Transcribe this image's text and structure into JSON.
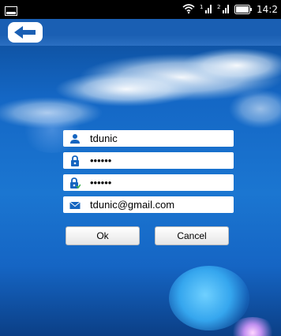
{
  "status": {
    "time": "14:2"
  },
  "header": {
    "back_icon": "back-arrow-icon"
  },
  "form": {
    "username": "tdunic",
    "password": "••••••",
    "confirm_password": "••••••",
    "email": "tdunic@gmail.com"
  },
  "buttons": {
    "ok_label": "Ok",
    "cancel_label": "Cancel"
  },
  "colors": {
    "accent": "#1a5fb3",
    "field_icon": "#1565c0"
  }
}
